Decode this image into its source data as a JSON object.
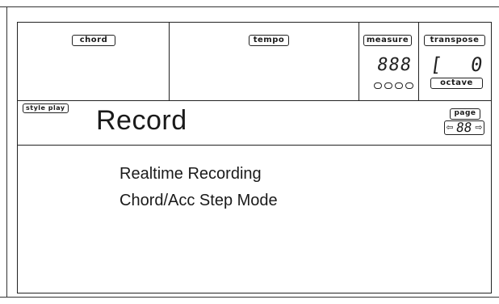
{
  "header": {
    "chord_label": "chord",
    "tempo_label": "tempo",
    "measure_label": "measure",
    "measure_value": "888",
    "transpose_label": "transpose",
    "transpose_left": "[",
    "transpose_right": "0",
    "octave_label": "octave"
  },
  "title_area": {
    "mode_badge": "style play",
    "title": "Record",
    "page_label": "page",
    "page_value": "88",
    "page_prev_icon": "arrow-left-icon",
    "page_next_icon": "arrow-right-icon"
  },
  "menu": {
    "items": [
      "Realtime Recording",
      "Chord/Acc Step Mode"
    ]
  }
}
